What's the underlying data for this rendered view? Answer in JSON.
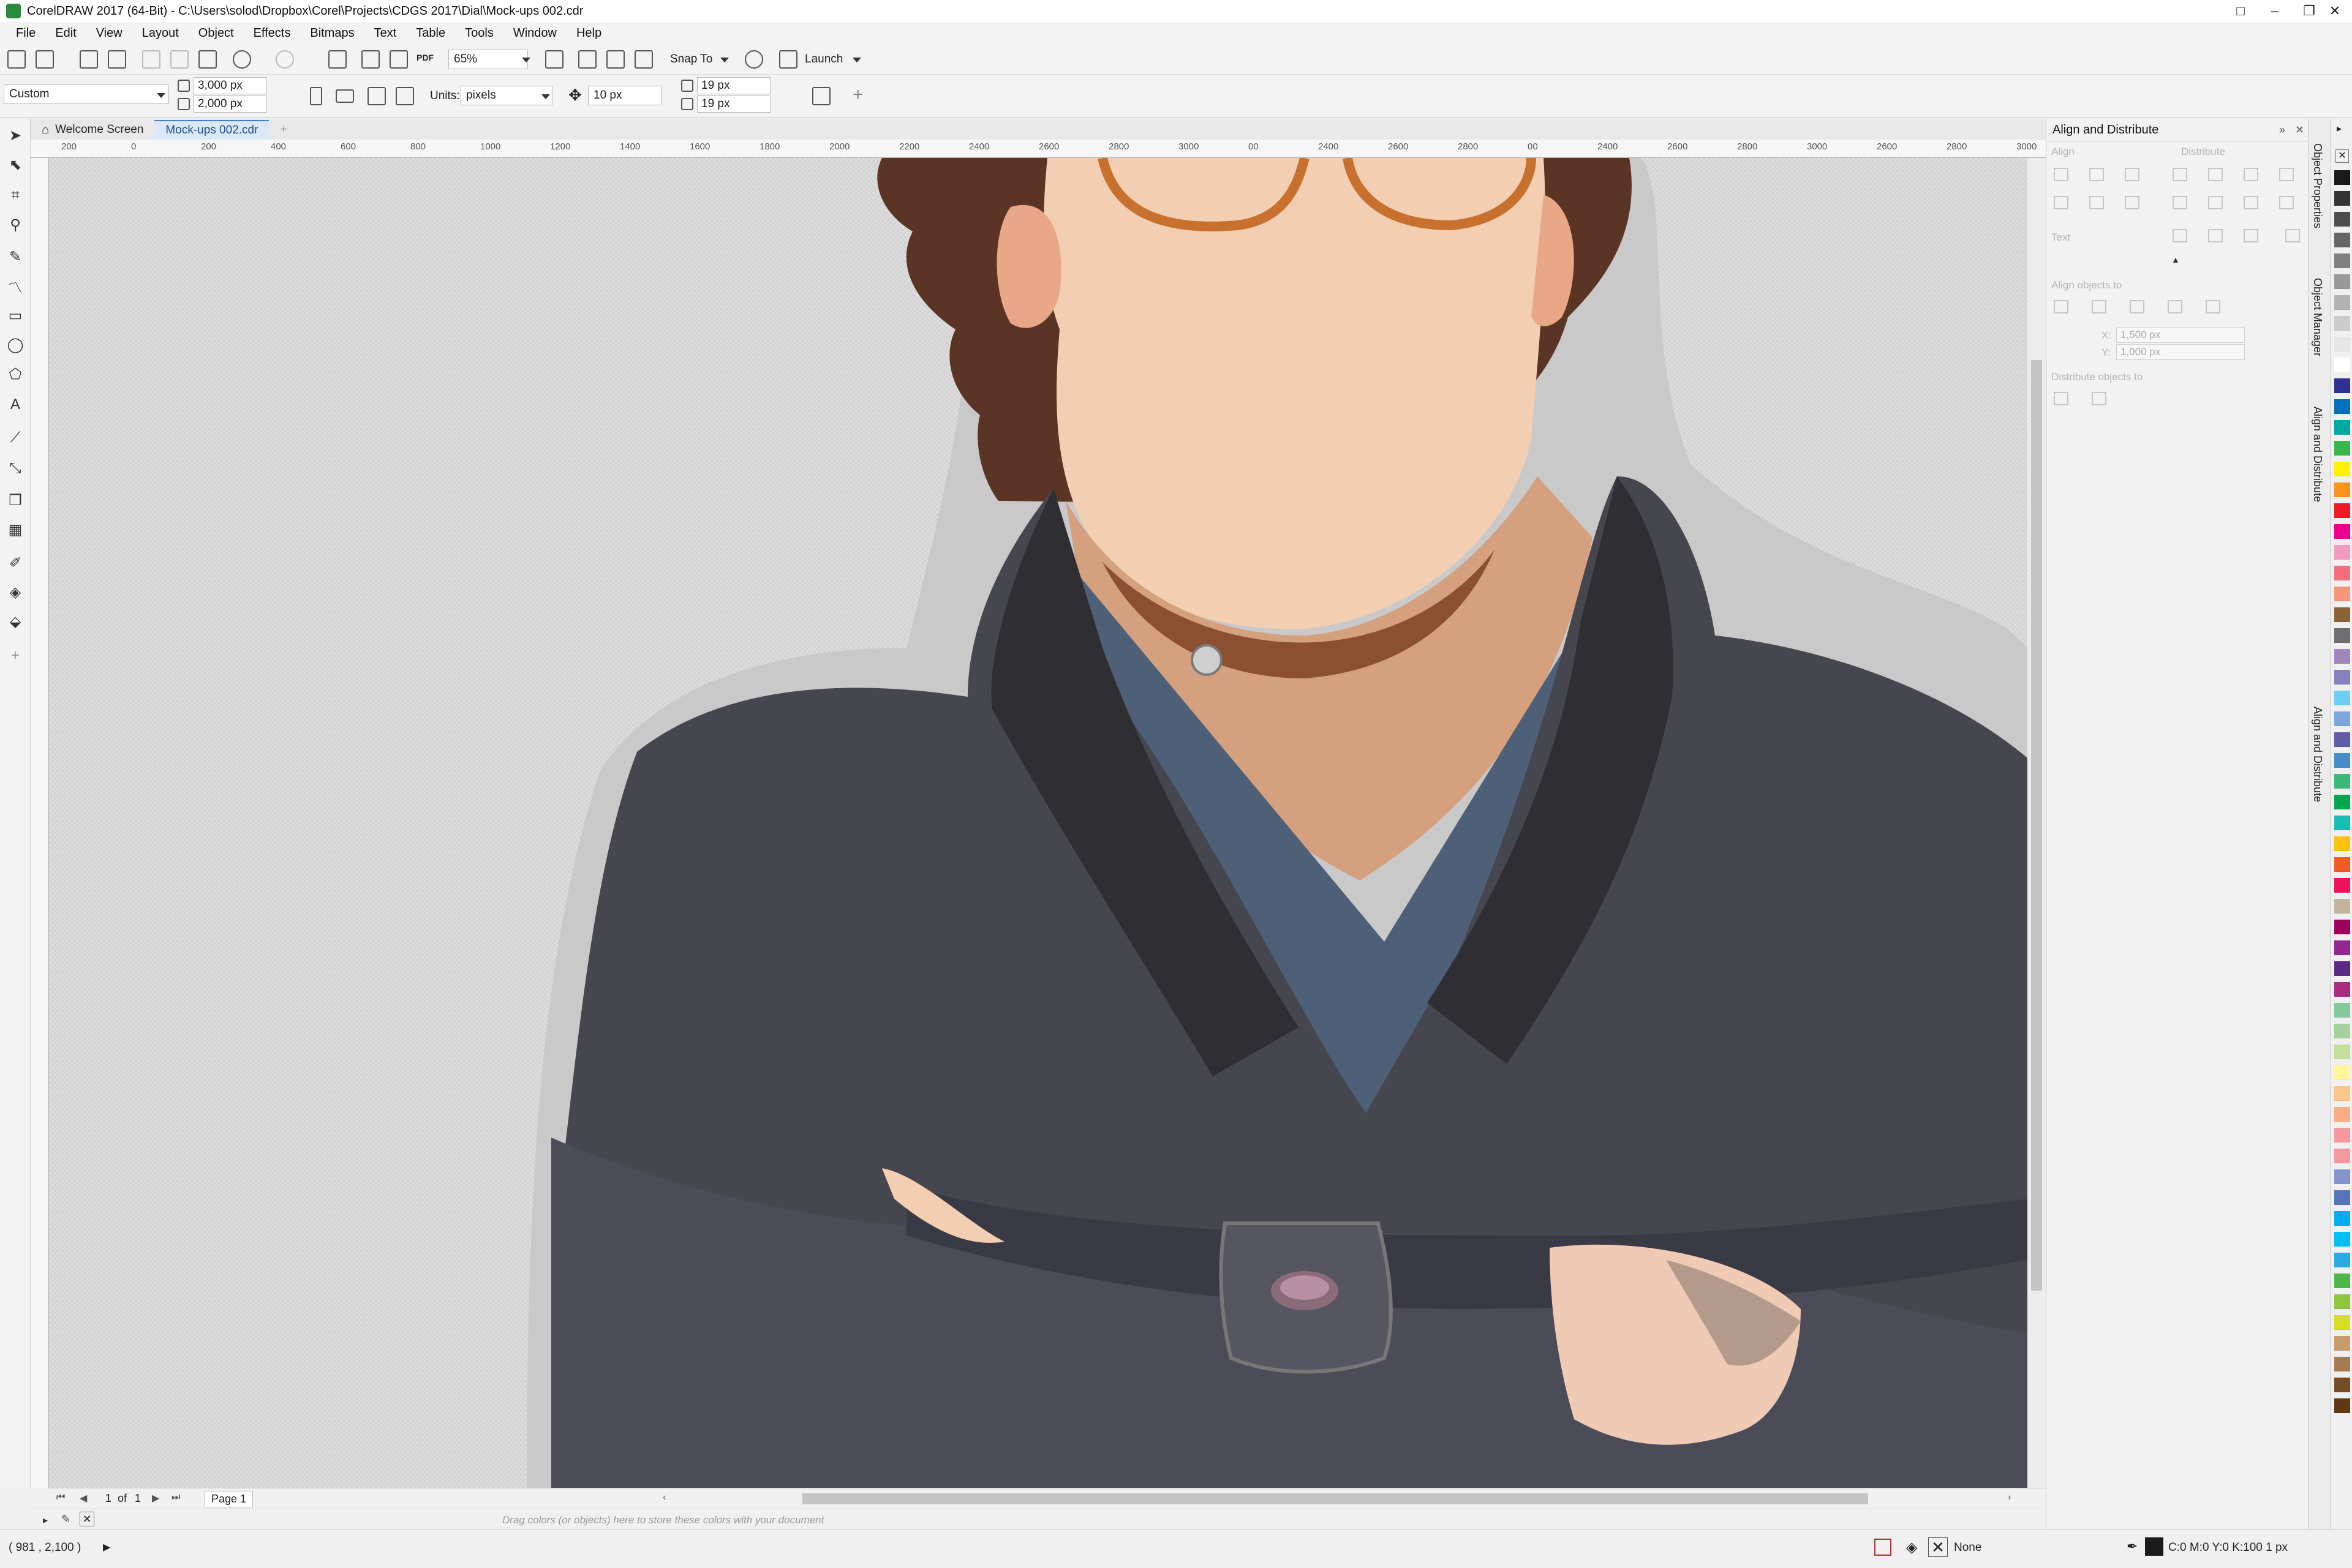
{
  "window": {
    "title": "CorelDRAW 2017 (64-Bit) - C:\\Users\\solod\\Dropbox\\Corel\\Projects\\CDGS 2017\\Dial\\Mock-ups 002.cdr",
    "controls": [
      "□",
      "–",
      "❐",
      "✕"
    ]
  },
  "menu": [
    "File",
    "Edit",
    "View",
    "Layout",
    "Object",
    "Effects",
    "Bitmaps",
    "Text",
    "Table",
    "Tools",
    "Window",
    "Help"
  ],
  "toolbar": {
    "zoom": "65%",
    "snap_label": "Snap To",
    "launch_label": "Launch",
    "pdf_label": "PDF"
  },
  "propbar": {
    "page_size": "Custom",
    "width": "3,000 px",
    "height": "2,000 px",
    "units_label": "Units:",
    "units_value": "pixels",
    "nudge": "10 px",
    "dup_x": "19 px",
    "dup_y": "19 px"
  },
  "tabs": {
    "welcome": "Welcome Screen",
    "document": "Mock-ups 002.cdr"
  },
  "ruler": {
    "labels": [
      "200",
      "0",
      "200",
      "400",
      "600",
      "800",
      "1000",
      "1200",
      "1400",
      "1600",
      "1800",
      "2000",
      "2200",
      "2400",
      "2600",
      "2800",
      "3000",
      "00",
      "2400",
      "2600",
      "2800",
      "00",
      "2400",
      "2600",
      "2800",
      "3000",
      "2600",
      "2800",
      "3000"
    ]
  },
  "page_nav": {
    "current": "1",
    "of_label": "of",
    "total": "1",
    "page_name": "Page 1"
  },
  "colorwell": {
    "hint": "Drag colors (or objects) here to store these colors with your document"
  },
  "status": {
    "coords": "( 981 , 2,100 )",
    "fill": "None",
    "outline": "C:0 M:0 Y:0 K:100  1 px"
  },
  "docker": {
    "title": "Align and Distribute",
    "align_label": "Align",
    "distribute_label": "Distribute",
    "text_label": "Text",
    "align_to_label": "Align objects to",
    "x_label": "X:",
    "x_value": "1,500 px",
    "y_label": "Y:",
    "y_value": "1,000 px",
    "distribute_to_label": "Distribute objects to"
  },
  "docker_tabs": [
    "Object Properties",
    "Object Manager",
    "Align and Distribute",
    "Align and Distribute"
  ],
  "palette_colors": [
    "#1a1a1a",
    "#333333",
    "#4d4d4d",
    "#666666",
    "#808080",
    "#999999",
    "#b3b3b3",
    "#cccccc",
    "#e6e6e6",
    "#ffffff",
    "#2e3192",
    "#0071bc",
    "#00a99d",
    "#39b54a",
    "#fff200",
    "#f7941d",
    "#ed1c24",
    "#ec008c",
    "#f49ac1",
    "#f26d7d",
    "#f7977a",
    "#8c6239",
    "#6d6e71",
    "#a186be",
    "#8781bd",
    "#6dcff6",
    "#7da7d9",
    "#605ca8",
    "#448ccb",
    "#3cb878",
    "#00a651",
    "#1cbbb4",
    "#ffc20e",
    "#f15a24",
    "#ee145b",
    "#c2b59b",
    "#9e005d",
    "#92278f",
    "#5b2a86",
    "#ab2b7f",
    "#82ca9c",
    "#a3d39c",
    "#c4df9b",
    "#fff799",
    "#fdc689",
    "#f9ad81",
    "#f6989d",
    "#f5989d",
    "#8493ca",
    "#5674b9",
    "#00aeef",
    "#00bff3",
    "#29abe2",
    "#4db848",
    "#8dc63f",
    "#d7df23",
    "#c69c6d",
    "#a67c52",
    "#754c24",
    "#603913"
  ]
}
